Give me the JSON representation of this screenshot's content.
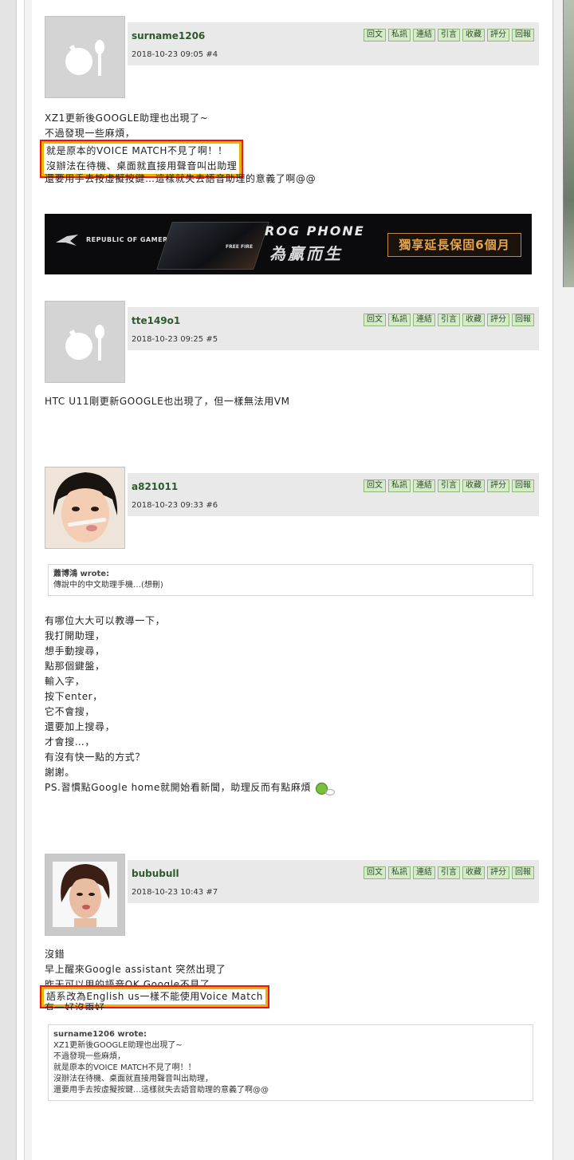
{
  "actions": [
    "回文",
    "私訊",
    "連結",
    "引言",
    "收藏",
    "評分",
    "回報"
  ],
  "posts": [
    {
      "user": "surname1206",
      "date": "2018-10-23 09:05",
      "num": "#4",
      "lines": [
        "XZ1更新後GOOGLE助理也出現了~",
        "不過發現一些麻煩，",
        "就是原本的VOICE MATCH不見了啊！！",
        "沒辦法在待機、桌面就直接用聲音叫出助理",
        "還要用手去按虛擬按鍵…這樣就失去語音助理的意義了啊@@"
      ]
    },
    {
      "user": "tte149o1",
      "date": "2018-10-23 09:25",
      "num": "#5",
      "lines": [
        "HTC U11剛更新GOOGLE也出現了，但一樣無法用VM"
      ]
    },
    {
      "user": "a821011",
      "date": "2018-10-23 09:33",
      "num": "#6",
      "quote_head": "蕭博鴻 wrote:",
      "quote_lines": [
        "傳說中的中文助理手機…(想刪)"
      ],
      "lines": [
        "有哪位大大可以教導一下，",
        "我打開助理，",
        "想手動搜尋，",
        "點那個鍵盤，",
        "輸入字，",
        "按下enter，",
        "它不會搜，",
        "還要加上搜尋，",
        "才會搜…，",
        "有沒有快一點的方式？",
        "謝謝。",
        "PS.習慣點Google home就開始看新聞，助理反而有點麻煩"
      ]
    },
    {
      "user": "bububull",
      "date": "2018-10-23 10:43",
      "num": "#7",
      "lines": [
        "沒錯",
        "早上醒來Google assistant 突然出現了",
        "昨天可以用的語音OK Google不見了",
        "語系改為English us一樣不能使用Voice Match",
        "有一好沒兩好"
      ],
      "quote_head": "surname1206 wrote:",
      "quote_lines": [
        "XZ1更新後GOOGLE助理也出現了~",
        "不過發現一些麻煩，",
        "就是原本的VOICE MATCH不見了啊！！",
        "沒辦法在待機、桌面就直接用聲音叫出助理，",
        "還要用手去按虛擬按鍵…這樣就失去語音助理的意義了啊@@"
      ]
    }
  ],
  "banner": {
    "brand": "REPUBLIC OF GAMERS",
    "product": "ROG PHONE",
    "slogan": "為贏而生",
    "game": "FREE FIRE",
    "offer": "獨享延長保固6個月"
  }
}
